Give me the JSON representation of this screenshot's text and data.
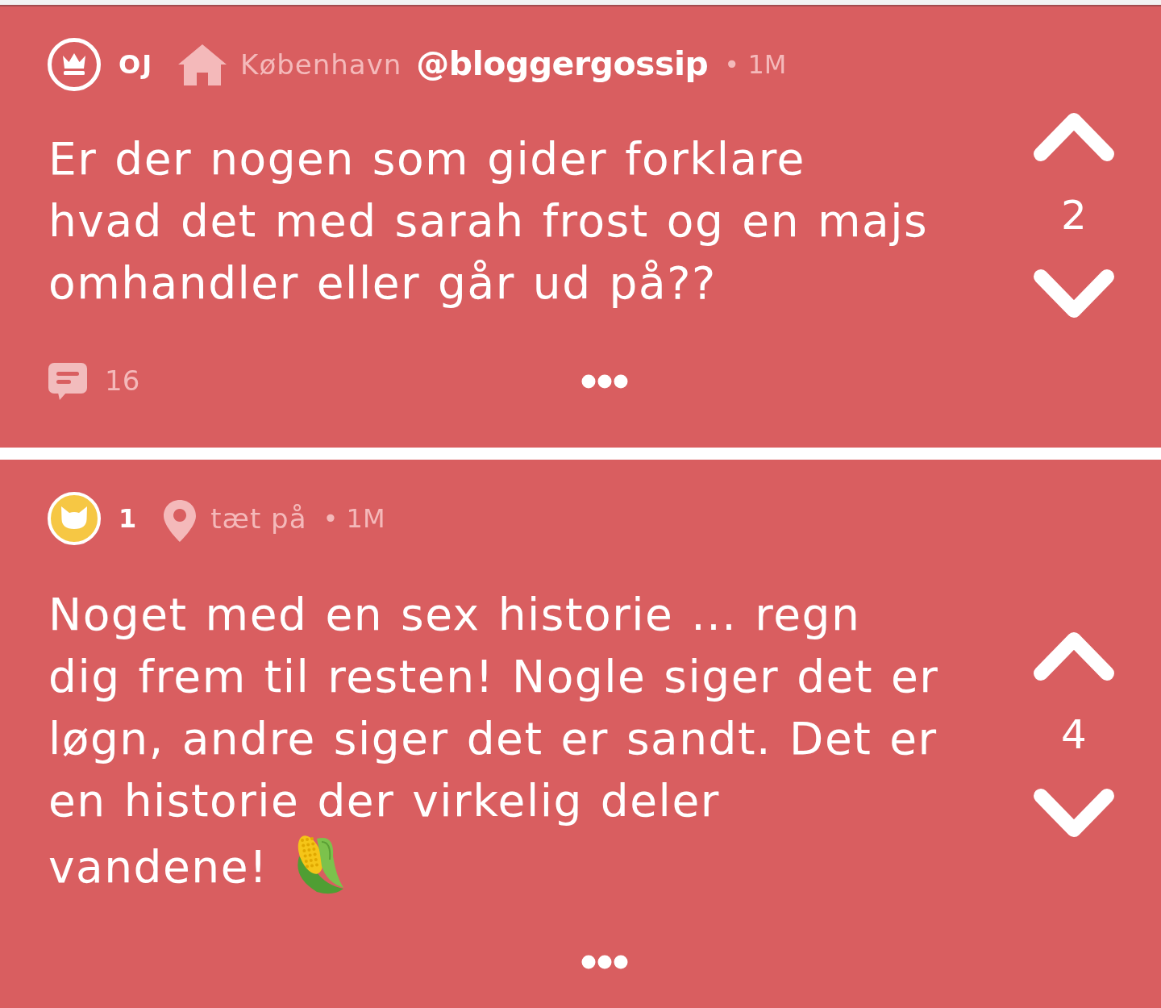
{
  "posts": [
    {
      "avatar": {
        "kind": "crown"
      },
      "author": "OJ",
      "location": {
        "kind": "home",
        "text": "København"
      },
      "handle": "@bloggergossip",
      "time": "• 1M",
      "text": "Er der nogen som gider forklare\nhvad det med sarah frost og en majs\nomhandler eller går ud på??",
      "votes": "2",
      "comments": "16"
    },
    {
      "avatar": {
        "kind": "cat"
      },
      "author": "1",
      "location": {
        "kind": "pin",
        "text": "tæt på"
      },
      "time": "• 1M",
      "text": "Noget med en sex historie ... regn\ndig frem til resten! Nogle siger det er\nløgn, andre siger det er sandt. Det er\nen historie der virkelig deler\nvandene!",
      "trailing_icon": {
        "kind": "corn"
      },
      "votes": "4"
    }
  ]
}
